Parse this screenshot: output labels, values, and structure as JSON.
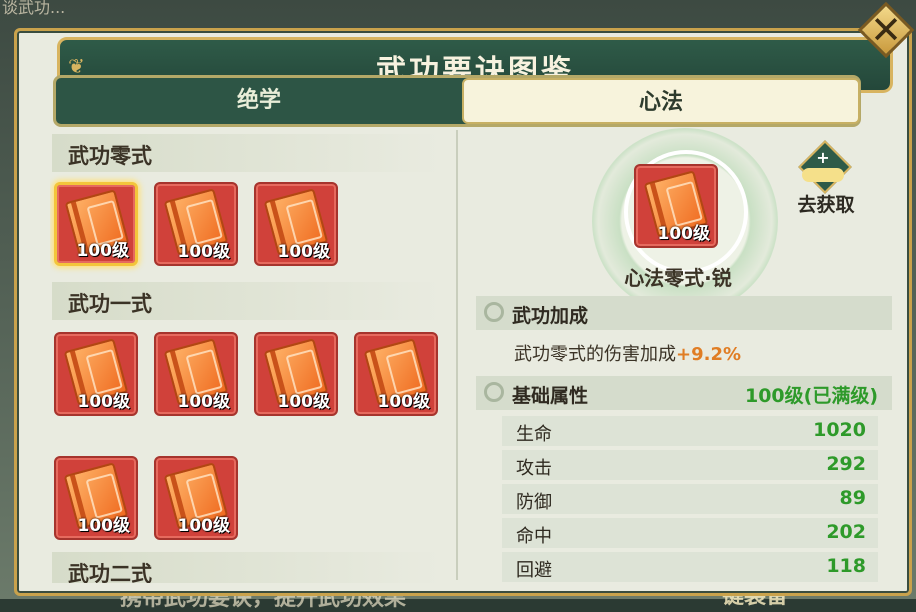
{
  "background": {
    "top_text": "谈武功...",
    "bottom_text": "携带武功要诀，提升武功效果",
    "bottom_button": "一键装备"
  },
  "window": {
    "title": "武功要诀图鉴",
    "close_icon": "close-x-icon"
  },
  "tabs": [
    {
      "label": "绝学",
      "active": false
    },
    {
      "label": "心法",
      "active": true
    }
  ],
  "sections": [
    {
      "title": "武功零式",
      "items": [
        {
          "level": "100级",
          "selected": true
        },
        {
          "level": "100级"
        },
        {
          "level": "100级"
        }
      ]
    },
    {
      "title": "武功一式",
      "items": [
        {
          "level": "100级"
        },
        {
          "level": "100级"
        },
        {
          "level": "100级"
        },
        {
          "level": "100级"
        },
        {
          "level": "100级"
        },
        {
          "level": "100级"
        }
      ]
    },
    {
      "title": "武功二式",
      "items": []
    }
  ],
  "detail": {
    "item_level": "100级",
    "item_name": "心法零式·锐",
    "get_button": "去获取",
    "bonus_header": "武功加成",
    "bonus_text": "武功零式的伤害加成",
    "bonus_value": "+9.2%",
    "base_header": "基础属性",
    "base_status": "100级(已满级)",
    "stats": [
      {
        "name": "生命",
        "value": "1020"
      },
      {
        "name": "攻击",
        "value": "292"
      },
      {
        "name": "防御",
        "value": "89"
      },
      {
        "name": "命中",
        "value": "202"
      },
      {
        "name": "回避",
        "value": "118"
      }
    ]
  },
  "colors": {
    "accent_green": "#2d5545",
    "gold_border": "#c9a24c",
    "stat_green": "#2e9a2a",
    "bonus_orange": "#e07d24",
    "slot_red": "#d0413a"
  }
}
